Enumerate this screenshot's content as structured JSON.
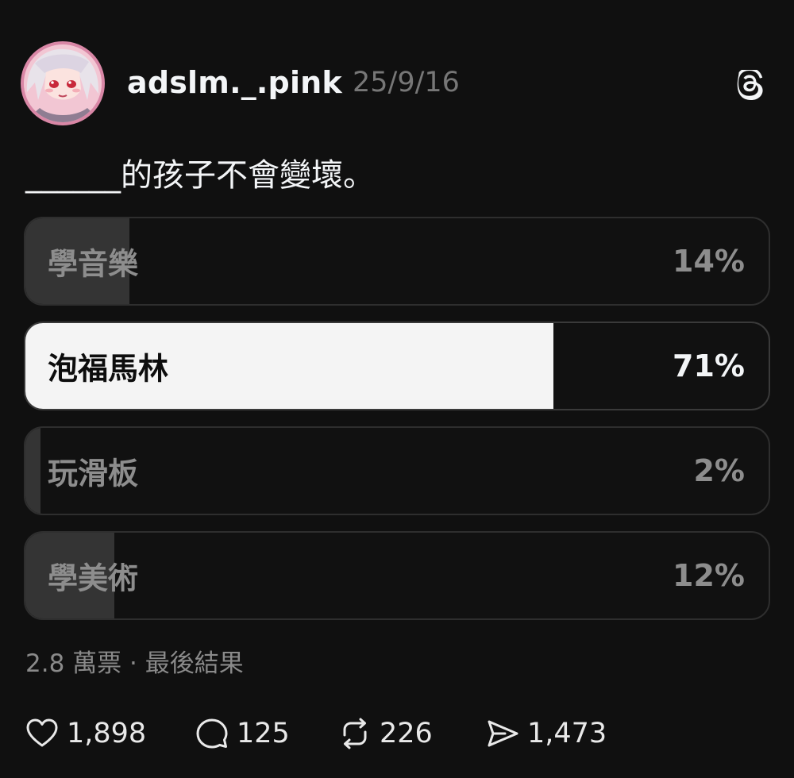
{
  "post": {
    "username": "adslm._.pink",
    "date": "25/9/16",
    "text": "______的孩子不會變壞。"
  },
  "poll": {
    "options": [
      {
        "label": "學音樂",
        "percent_text": "14%",
        "percent": 14,
        "winner": false
      },
      {
        "label": "泡福馬林",
        "percent_text": "71%",
        "percent": 71,
        "winner": true
      },
      {
        "label": "玩滑板",
        "percent_text": "2%",
        "percent": 2,
        "winner": false
      },
      {
        "label": "學美術",
        "percent_text": "12%",
        "percent": 12,
        "winner": false
      }
    ],
    "summary": "2.8 萬票 · 最後結果"
  },
  "actions": {
    "likes": "1,898",
    "replies": "125",
    "reposts": "226",
    "shares": "1,473"
  },
  "colors": {
    "background": "#101010",
    "bar_fill": "#343434",
    "winner_fill": "#f4f4f4",
    "muted_text": "#8d8d8d"
  },
  "icons": {
    "brand": "threads-icon",
    "like": "heart-icon",
    "reply": "comment-icon",
    "repost": "repost-icon",
    "share": "send-icon"
  }
}
